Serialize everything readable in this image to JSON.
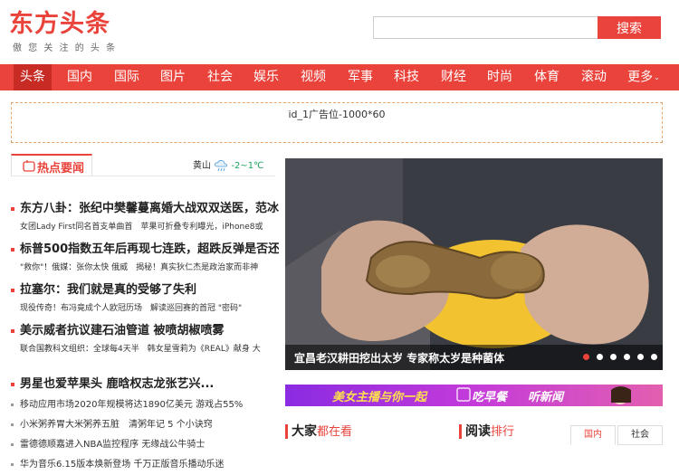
{
  "logo": {
    "title": "东方头条",
    "subtitle": "傲 您 关 注 的 头 条"
  },
  "search": {
    "value": "",
    "placeholder": "",
    "button": "搜索"
  },
  "nav": {
    "items": [
      "头条",
      "国内",
      "国际",
      "图片",
      "社会",
      "娱乐",
      "视频",
      "军事",
      "科技",
      "财经",
      "时尚",
      "体育",
      "滚动",
      "更多"
    ],
    "active_index": 0
  },
  "ad": {
    "text": "id_1广告位-1000*60"
  },
  "hot": {
    "tab_label": "热点要闻"
  },
  "weather": {
    "city": "黄山",
    "temp": "-2~1℃"
  },
  "headlines": [
    {
      "title": "东方八卦：张纪中樊馨蔓离婚大战双双送医，范冰",
      "sub": "女团Lady First同名首支单曲首　苹果可折叠专利曝光，iPhone8或"
    },
    {
      "title": "标普500指数五年后再现七连跌，超跌反弹是否还",
      "sub": "\"救你\"！俄媒：张你太快 俄威　揭秘！真实狄仁杰是政治家而非神"
    },
    {
      "title": "拉塞尔：我们就是真的受够了失利",
      "sub": "现役传奇！布冯竟成个人欧冠历场　解读巡回赛的首冠 \"密码\""
    },
    {
      "title": "美示威者抗议建石油管道 被喷胡椒喷雾",
      "sub": "联合国教科文组织：全球每4天半　韩女星雪莉为《REAL》献身 大"
    }
  ],
  "list_headline": "男星也爱苹果头 鹿晗权志龙张艺兴...",
  "news_list": [
    "移动应用市场2020年规模将达1890亿美元 游戏占55%",
    "小米粥养胃大米粥养五脏　清粥年记 5 个小诀窍",
    "雷德德顺嘉进入NBA监控程序 无缘战公牛骑士",
    "华为音乐6.15版本焕新登场 千万正版音乐播动乐迷"
  ],
  "slide": {
    "caption": "宜昌老汉耕田挖出太岁 专家称太岁是种菌体",
    "dot_count": 6,
    "active_dot": 0
  },
  "banner": {
    "text1": "美女主播与你一起",
    "text2": "吃早餐",
    "text3": "听新闻"
  },
  "section_everyone": {
    "title": "大家",
    "accent": "都在看"
  },
  "section_reading": {
    "title": "阅读",
    "accent": "排行",
    "tabs": [
      "国内",
      "社会"
    ],
    "active_tab": 0
  }
}
